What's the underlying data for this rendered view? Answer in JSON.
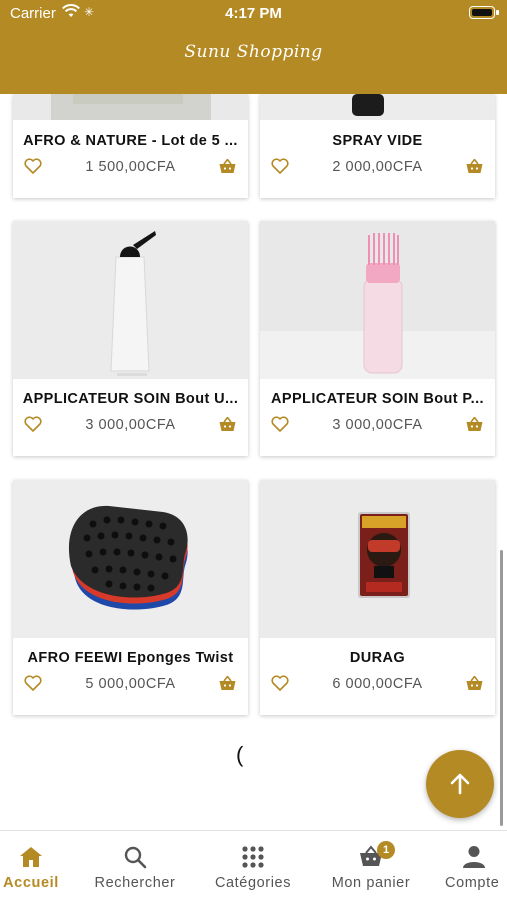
{
  "status_bar": {
    "carrier": "Carrier",
    "time": "4:17 PM"
  },
  "header": {
    "brand": "Sunu Shopping"
  },
  "colors": {
    "brand": "#b48a24",
    "card_image_bg": "#e9e9e9"
  },
  "products": [
    {
      "name": "AFRO & NATURE - Lot de 5 ...",
      "price": "1 500,00CFA",
      "image": "product-photo"
    },
    {
      "name": "SPRAY VIDE",
      "price": "2 000,00CFA",
      "image": "spray-bottle"
    },
    {
      "name": "APPLICATEUR SOIN Bout U...",
      "price": "3 000,00CFA",
      "image": "applicator-bottle-clear"
    },
    {
      "name": "APPLICATEUR SOIN Bout P...",
      "price": "3 000,00CFA",
      "image": "applicator-bottle-pink"
    },
    {
      "name": "AFRO FEEWI Eponges Twist",
      "price": "5 000,00CFA",
      "image": "twist-sponge"
    },
    {
      "name": "DURAG",
      "price": "6 000,00CFA",
      "image": "durag-package"
    }
  ],
  "loader": "(",
  "tabbar": {
    "tabs": [
      {
        "label": "Accueil",
        "icon": "home-icon",
        "active": true
      },
      {
        "label": "Rechercher",
        "icon": "search-icon"
      },
      {
        "label": "Catégories",
        "icon": "grid-icon"
      },
      {
        "label": "Mon panier",
        "icon": "basket-icon",
        "badge": "1"
      },
      {
        "label": "Compte",
        "icon": "person-icon"
      }
    ]
  }
}
